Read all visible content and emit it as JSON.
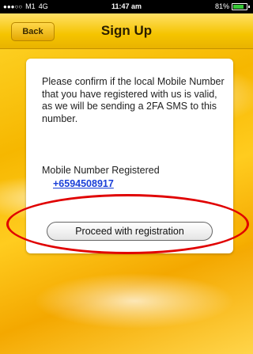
{
  "status_bar": {
    "carrier": "M1",
    "network": "4G",
    "time": "11:47 am",
    "battery": "81%"
  },
  "navbar": {
    "back_label": "Back",
    "title": "Sign Up"
  },
  "card": {
    "message": "Please confirm if the local Mobile Number that you have registered with us is valid, as we will be sending a 2FA SMS to this number.",
    "registered_label": "Mobile Number Registered",
    "registered_number": "+6594508917",
    "proceed_label": "Proceed with registration"
  },
  "colors": {
    "accent_yellow": "#f5c400",
    "link_blue": "#1a3fd8",
    "annotation_red": "#e00000"
  }
}
